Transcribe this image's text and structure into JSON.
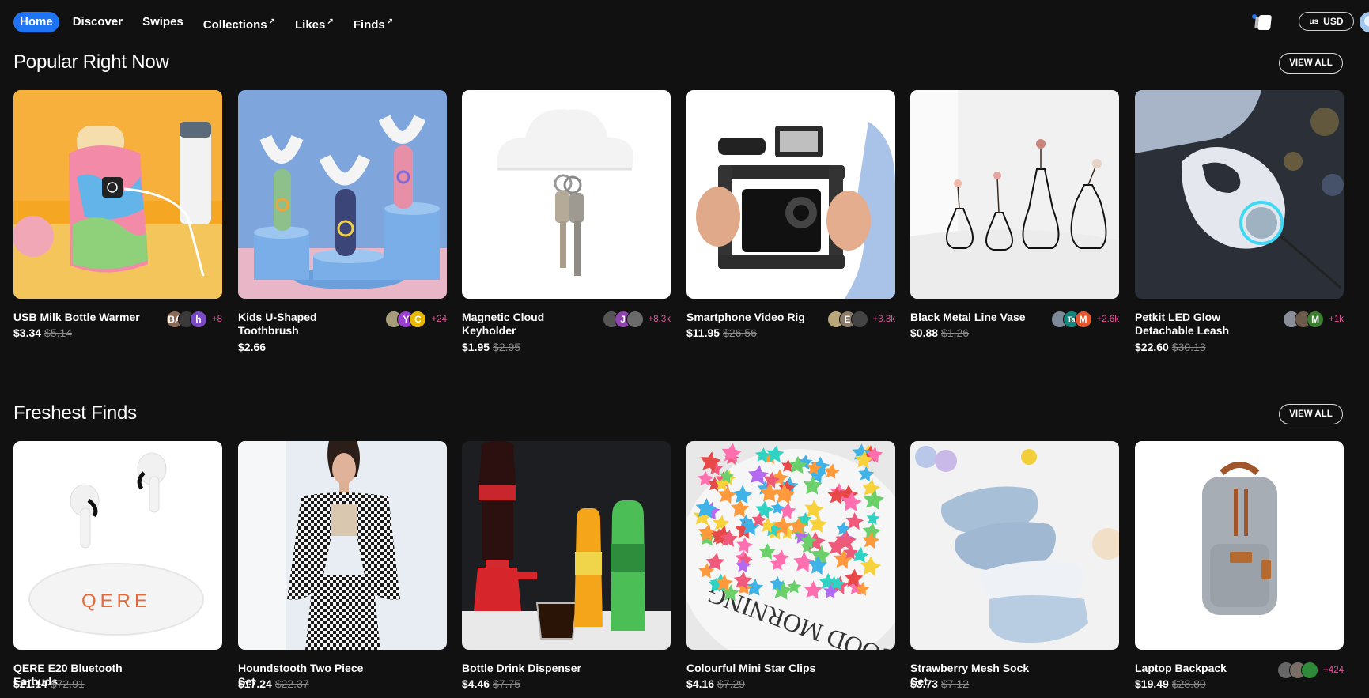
{
  "nav": {
    "items": [
      {
        "label": "Home",
        "external": false,
        "active": true
      },
      {
        "label": "Discover",
        "external": false,
        "active": false
      },
      {
        "label": "Swipes",
        "external": false,
        "active": false
      },
      {
        "label": "Collections",
        "external": true,
        "active": false
      },
      {
        "label": "Likes",
        "external": true,
        "active": false
      },
      {
        "label": "Finds",
        "external": true,
        "active": false
      }
    ],
    "external_glyph": "↗"
  },
  "header_right": {
    "currency_flag": "us",
    "currency_label": "USD",
    "icons": [
      "swipe-cards-icon",
      "profile-avatar"
    ]
  },
  "sections": [
    {
      "title": "Popular Right Now",
      "view_all_label": "VIEW ALL",
      "products": [
        {
          "name": "USB Milk Bottle Warmer",
          "price": "$3.34",
          "original_price": "$5.14",
          "likers": [
            {
              "initial": "BA",
              "color": "#8a6a55"
            },
            {
              "initial": "",
              "color": "#3a3a3a"
            },
            {
              "initial": "h",
              "color": "#7b4bc5"
            }
          ],
          "like_count": "+8",
          "image": "bottle-warmer"
        },
        {
          "name": "Kids U-Shaped Toothbrush",
          "price": "$2.66",
          "original_price": "",
          "likers": [
            {
              "initial": "",
              "color": "#a79d7a"
            },
            {
              "initial": "Y",
              "color": "#9b3fd1"
            },
            {
              "initial": "C",
              "color": "#e8b800"
            }
          ],
          "like_count": "+24",
          "image": "toothbrush"
        },
        {
          "name": "Magnetic Cloud Keyholder",
          "price": "$1.95",
          "original_price": "$2.95",
          "likers": [
            {
              "initial": "",
              "color": "#555555"
            },
            {
              "initial": "J",
              "color": "#8e44ad"
            },
            {
              "initial": "",
              "color": "#6b6b6b"
            }
          ],
          "like_count": "+8.3k",
          "image": "cloud-keys"
        },
        {
          "name": "Smartphone Video Rig",
          "price": "$11.95",
          "original_price": "$26.56",
          "likers": [
            {
              "initial": "",
              "color": "#b8a77a"
            },
            {
              "initial": "E",
              "color": "#8d7b6a"
            },
            {
              "initial": "",
              "color": "#444444"
            }
          ],
          "like_count": "+3.3k",
          "image": "video-rig"
        },
        {
          "name": "Black Metal Line Vase",
          "price": "$0.88",
          "original_price": "$1.26",
          "likers": [
            {
              "initial": "",
              "color": "#7c8a99"
            },
            {
              "initial": "Ta",
              "color": "#14857a"
            },
            {
              "initial": "M",
              "color": "#e2572d"
            }
          ],
          "like_count": "+2.6k",
          "image": "vase"
        },
        {
          "name": "Petkit LED Glow Detachable Leash",
          "price": "$22.60",
          "original_price": "$30.13",
          "likers": [
            {
              "initial": "",
              "color": "#8a8f99"
            },
            {
              "initial": "",
              "color": "#6c5a4a"
            },
            {
              "initial": "M",
              "color": "#3b7d2f"
            }
          ],
          "like_count": "+1k",
          "image": "leash"
        }
      ]
    },
    {
      "title": "Freshest Finds",
      "view_all_label": "VIEW ALL",
      "products": [
        {
          "name": "QERE E20 Bluetooth Earbuds",
          "price": "$21.14",
          "original_price": "$72.91",
          "likers": [],
          "like_count": "",
          "image": "earbuds",
          "brand_text": "QERE"
        },
        {
          "name": "Houndstooth Two Piece Set",
          "price": "$17.24",
          "original_price": "$22.37",
          "likers": [],
          "like_count": "",
          "image": "houndstooth"
        },
        {
          "name": "Bottle Drink Dispenser",
          "price": "$4.46",
          "original_price": "$7.75",
          "likers": [],
          "like_count": "",
          "image": "dispenser"
        },
        {
          "name": "Colourful Mini Star Clips",
          "price": "$4.16",
          "original_price": "$7.29",
          "likers": [],
          "like_count": "",
          "image": "star-clips",
          "plate_text": "GOOD MORNING"
        },
        {
          "name": "Strawberry Mesh Sock Set",
          "price": "$3.73",
          "original_price": "$7.12",
          "likers": [],
          "like_count": "",
          "image": "socks"
        },
        {
          "name": "Laptop Backpack",
          "price": "$19.49",
          "original_price": "$28.80",
          "likers": [
            {
              "initial": "",
              "color": "#666666"
            },
            {
              "initial": "",
              "color": "#7a6f66"
            },
            {
              "initial": "",
              "color": "#2f8a3a"
            }
          ],
          "like_count": "+424",
          "image": "backpack"
        }
      ]
    }
  ]
}
